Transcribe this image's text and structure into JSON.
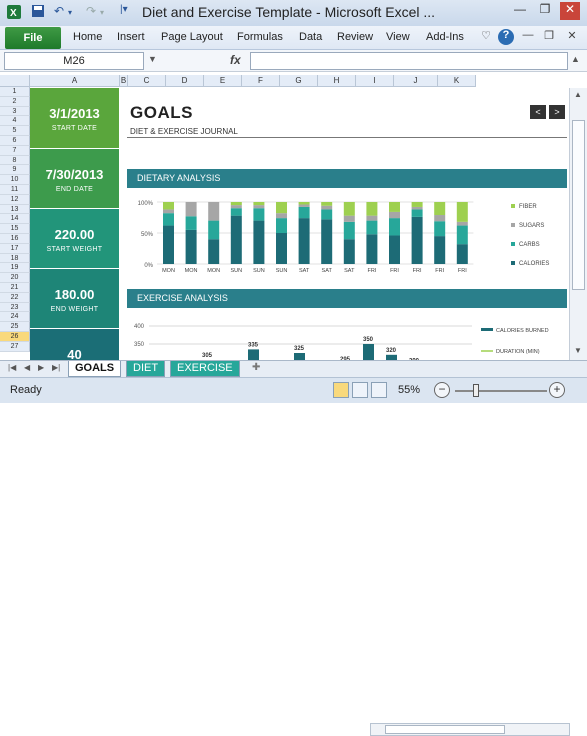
{
  "window": {
    "title": "Diet and Exercise Template  -  Microsoft Excel ...",
    "quick_access": [
      "save-icon",
      "undo-icon",
      "redo-icon",
      "customize-icon"
    ]
  },
  "ribbon": {
    "file_label": "File",
    "tabs": [
      "Home",
      "Insert",
      "Page Layout",
      "Formulas",
      "Data",
      "Review",
      "View",
      "Add-Ins"
    ]
  },
  "formula_bar": {
    "name_box": "M26",
    "fx_label": "fx",
    "formula": ""
  },
  "columns": [
    "A",
    "B",
    "C",
    "D",
    "E",
    "F",
    "G",
    "H",
    "I",
    "J",
    "K"
  ],
  "rows": [
    "1",
    "2",
    "3",
    "4",
    "5",
    "6",
    "7",
    "8",
    "9",
    "10",
    "11",
    "12",
    "13",
    "14",
    "15",
    "16",
    "17",
    "18",
    "19",
    "20",
    "21",
    "22",
    "23",
    "24",
    "25",
    "26",
    "27"
  ],
  "selected_row": "26",
  "sidebar": [
    {
      "value": "3/1/2013",
      "label": "START DATE",
      "color": "#5aa63c"
    },
    {
      "value": "7/30/2013",
      "label": "END DATE",
      "color": "#3d9b4c"
    },
    {
      "value": "220.00",
      "label": "START WEIGHT",
      "color": "#22957a"
    },
    {
      "value": "180.00",
      "label": "END WEIGHT",
      "color": "#1e8577"
    },
    {
      "value": "40",
      "label": "",
      "color": "#1b6e76"
    }
  ],
  "goals": {
    "title": "GOALS",
    "subtitle": "DIET & EXERCISE JOURNAL",
    "prev_label": "<",
    "next_label": ">"
  },
  "dietary": {
    "header": "DIETARY ANALYSIS",
    "chart_data": {
      "type": "bar",
      "stacked": true,
      "percent": true,
      "categories": [
        "MON",
        "MON",
        "MON",
        "SUN",
        "SUN",
        "SUN",
        "SAT",
        "SAT",
        "SAT",
        "FRI",
        "FRI",
        "FRI",
        "FRI",
        "FRI"
      ],
      "yticks": [
        "0%",
        "50%",
        "100%"
      ],
      "series": [
        {
          "name": "CALORIES",
          "color": "#1d6b76",
          "values": [
            0.62,
            0.55,
            0.4,
            0.78,
            0.7,
            0.5,
            0.74,
            0.72,
            0.4,
            0.48,
            0.46,
            0.76,
            0.45,
            0.32
          ]
        },
        {
          "name": "CARBS",
          "color": "#27a79a",
          "values": [
            0.2,
            0.22,
            0.3,
            0.12,
            0.2,
            0.24,
            0.18,
            0.16,
            0.28,
            0.22,
            0.28,
            0.12,
            0.24,
            0.3
          ]
        },
        {
          "name": "SUGARS",
          "color": "#a6a6a6",
          "values": [
            0.06,
            0.23,
            0.3,
            0.05,
            0.05,
            0.08,
            0.04,
            0.06,
            0.1,
            0.08,
            0.1,
            0.04,
            0.1,
            0.06
          ]
        },
        {
          "name": "FIBER",
          "color": "#9ed050",
          "values": [
            0.12,
            0.0,
            0.0,
            0.05,
            0.05,
            0.18,
            0.04,
            0.06,
            0.22,
            0.22,
            0.16,
            0.08,
            0.21,
            0.32
          ]
        }
      ]
    }
  },
  "exercise": {
    "header": "EXERCISE ANALYSIS",
    "chart_data": {
      "type": "bar",
      "ylim": [
        0,
        400
      ],
      "yticks": [
        "400",
        "350"
      ],
      "data_labels": [
        "305",
        "335",
        "325",
        "295",
        "350",
        "320",
        "290"
      ],
      "values": [
        305,
        335,
        325,
        295,
        350,
        320,
        290
      ],
      "series": [
        {
          "name": "CALORIES BURNED",
          "color": "#1d6b76"
        },
        {
          "name": "DURATION (MIN)",
          "color": "#9ed050"
        }
      ]
    }
  },
  "sheets": {
    "tabs": [
      "GOALS",
      "DIET",
      "EXERCISE"
    ],
    "active": "GOALS"
  },
  "status": {
    "ready": "Ready",
    "zoom": "55%",
    "zoom_out": "−",
    "zoom_in": "+"
  }
}
